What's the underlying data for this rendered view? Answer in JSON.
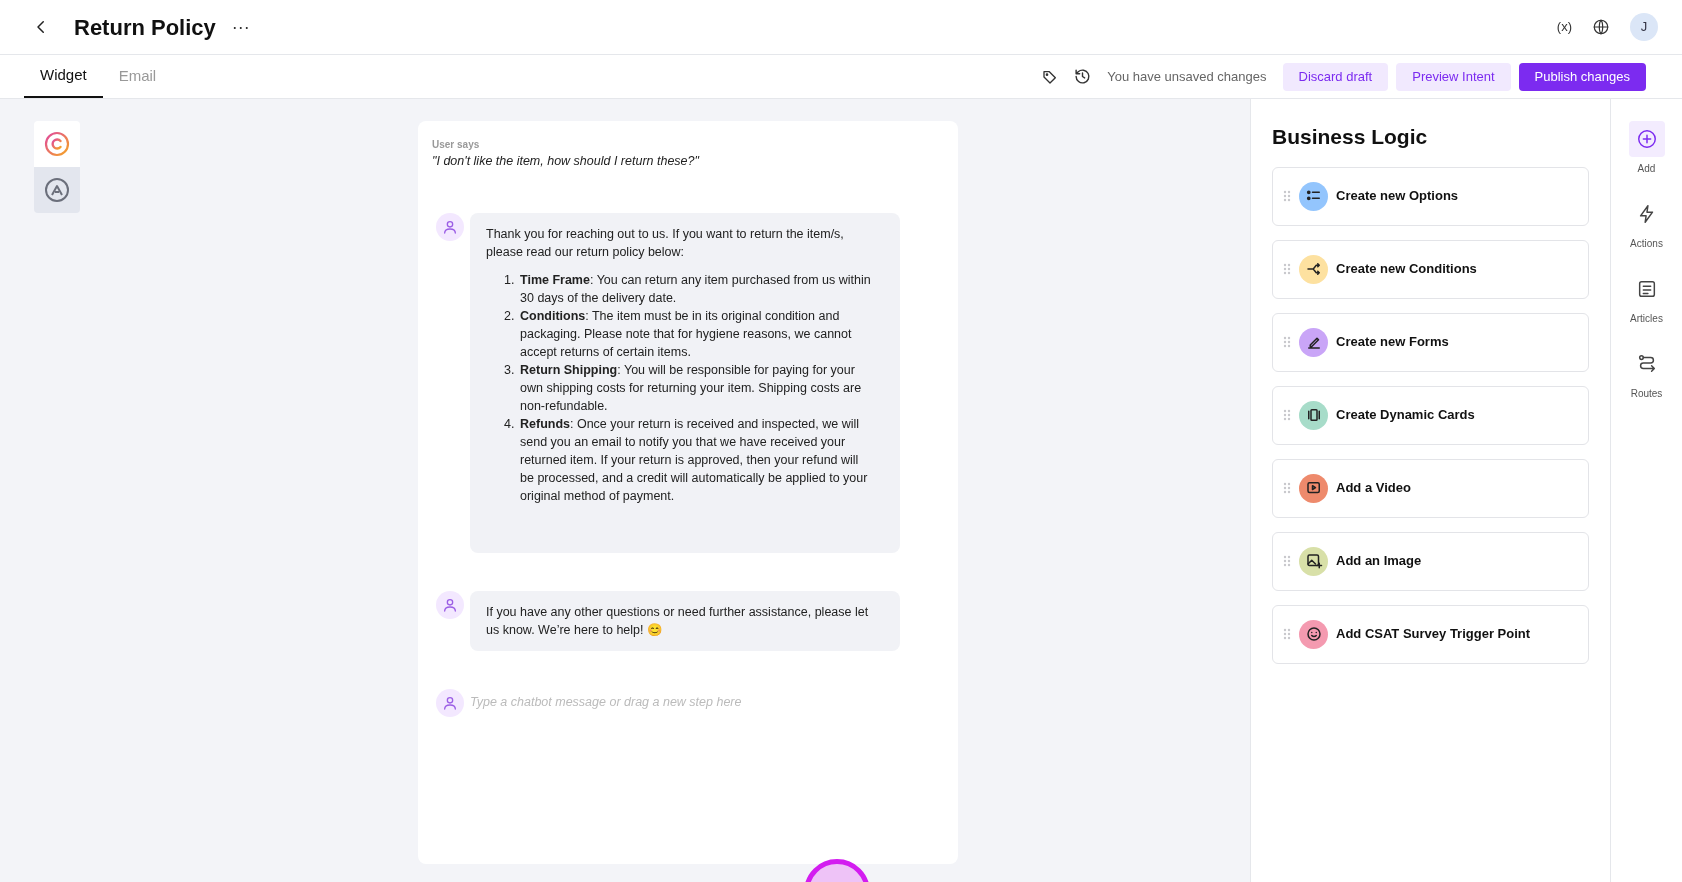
{
  "header": {
    "title": "Return Policy",
    "more": "···",
    "variable_button": "(x)",
    "avatar": "J"
  },
  "tabs": [
    {
      "label": "Widget",
      "selected": true
    },
    {
      "label": "Email",
      "selected": false
    }
  ],
  "toolbar": {
    "status": "You have unsaved changes",
    "buttons": [
      {
        "label": "Discard draft",
        "kind": "secondary"
      },
      {
        "label": "Preview Intent",
        "kind": "secondary"
      },
      {
        "label": "Publish changes",
        "kind": "primary"
      }
    ]
  },
  "channels": [
    {
      "kind": "logo-c",
      "selected": true
    },
    {
      "kind": "logo-a",
      "selected": false
    }
  ],
  "conversation": {
    "user_label": "User says",
    "user_message": "\"I don't like the item, how should I return these?\"",
    "bot_messages": [
      {
        "intro": "Thank you for reaching out to us. If you want to return the item/s, please read our return policy below:",
        "items": [
          {
            "marker": "1.",
            "text": "**Time Frame**: You can return any item purchased from us within 30 days of the delivery date."
          },
          {
            "marker": "2.",
            "text": "**Conditions**: The item must be in its original condition and packaging. Please note that for hygiene reasons, we cannot accept returns of certain items."
          },
          {
            "marker": "3.",
            "text": "**Return Shipping**: You will be responsible for paying for your own shipping costs for returning your item. Shipping costs are non-refundable."
          },
          {
            "marker": "4.",
            "text": "**Refunds**: Once your return is received and inspected, we will send you an email to notify you that we have received your returned item. If your return is approved, then your refund will be processed, and a credit will automatically be applied to your original method of payment."
          }
        ]
      },
      {
        "intro": "If you have any other questions or need further assistance, please let us know. We’re here to help! 😊"
      }
    ],
    "input_placeholder": "Type a chatbot message or drag a new step here"
  },
  "business_logic": {
    "title": "Business Logic",
    "items": [
      {
        "label": "Create new Options",
        "kind": "options",
        "color": "#93c5fd"
      },
      {
        "label": "Create new Conditions",
        "kind": "conditions",
        "color": "#fde1a0"
      },
      {
        "label": "Create new Forms",
        "kind": "forms",
        "color": "#c9a5f7"
      },
      {
        "label": "Create Dynamic Cards",
        "kind": "cards",
        "color": "#a7dcc9"
      },
      {
        "label": "Add a Video",
        "kind": "video",
        "color": "#ee8a6c"
      },
      {
        "label": "Add an Image",
        "kind": "image",
        "color": "#d8e0a8"
      },
      {
        "label": "Add CSAT Survey Trigger Point",
        "kind": "csat",
        "color": "#f49ab0"
      }
    ]
  },
  "rail": [
    {
      "label": "Add",
      "kind": "add",
      "selected": true
    },
    {
      "label": "Actions",
      "kind": "actions",
      "selected": false
    },
    {
      "label": "Articles",
      "kind": "articles",
      "selected": false
    },
    {
      "label": "Routes",
      "kind": "routes",
      "selected": false
    }
  ]
}
